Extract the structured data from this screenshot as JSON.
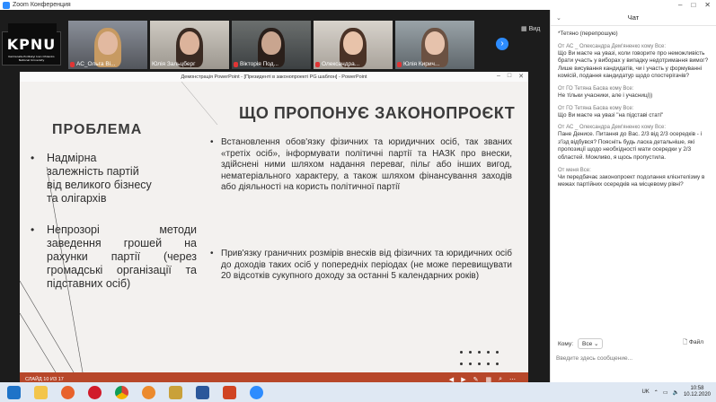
{
  "window": {
    "title": "Zoom Конференция"
  },
  "logo": {
    "text": "KPNU",
    "subtitle": "Kamianets-Podilskyi Ivan Ohiienko National University"
  },
  "participants": [
    {
      "name": "АС_Ольга Ві..."
    },
    {
      "name": "Юлія Зальцберг"
    },
    {
      "name": "Вікторія Под..."
    },
    {
      "name": "Олександра..."
    },
    {
      "name": "Юлія Кирич..."
    }
  ],
  "view_label": "Вид",
  "ppt": {
    "title": "Демонстрація PowerPoint - [Президенті в законопроекті PG шаблон] - PowerPoint",
    "status": "СЛАЙД 10 ИЗ 17"
  },
  "slide": {
    "left_heading": "ПРОБЛЕМА",
    "right_heading": "ЩО ПРОПОНУЄ ЗАКОНОПРОЄКТ",
    "problems": [
      "Надмірна залежність партій від великого бізнесу та олігархів",
      "Непрозорі методи заведення грошей на рахунки партії (через громадські організації та підставних осіб)"
    ],
    "proposals": [
      "Встановлення обов'язку фізичних та юридичних осіб, так званих «третіх осіб», інформувати політичні партії та НАЗК про внески, здійснені ними шляхом надання переваг, пільг або інших вигод, нематеріального характеру, а також шляхом фінансування заходів або діяльності на користь політичної партії",
      "Прив'язку граничних розмірів внесків від фізичних та юридичних осіб до доходів таких осіб у попередніх періодах (не може перевищувати 20 відсотків сукупного доходу за останні 5 календарних років)"
    ]
  },
  "chat": {
    "title": "Чат",
    "messages": [
      {
        "meta": "",
        "from": "",
        "to": "",
        "text": "*Тетяно (перепрошую)"
      },
      {
        "meta": "От АС _ Олександра Дем'яненко кому Все:",
        "text": "Що Ви маєте на увазі, коли говорите про неможливість брати участь у виборах у випадку недотримання вимог? Лише висування кандидатів, чи і участь у формуванні комісій, подання кандидатур щодо спостерігачів?"
      },
      {
        "meta": "От ГО Тетяна Басва кому Все:",
        "text": "Не тільки учасники, але і учасниці))"
      },
      {
        "meta": "От ГО Тетяна Басва кому Все:",
        "text": "Що Ви маєте на увазі \"на підставі статі\""
      },
      {
        "meta": "От АС _ Олександра Дем'яненко кому Все:",
        "text": "Пане Денисе. Питання до Вас. 2/3 від 2/3 осередків - і з'їзд відбувся? Поясніть будь ласка детальніше, які пропозиції щодо необхідності мати осередки у 2/3 областей. Можливо, я щось пропустила."
      },
      {
        "meta": "От меня Все:",
        "text": "Чи передбачає законопроект подолання клієнтелізму в межах партійних осередків на місцевому рівні?"
      }
    ],
    "to_label": "Кому:",
    "to_value": "Все",
    "file_label": "Файл",
    "input_placeholder": "Введите здесь сообщение..."
  },
  "taskbar": {
    "lang": "UK",
    "time": "10:58",
    "date": "10.12.2020"
  }
}
